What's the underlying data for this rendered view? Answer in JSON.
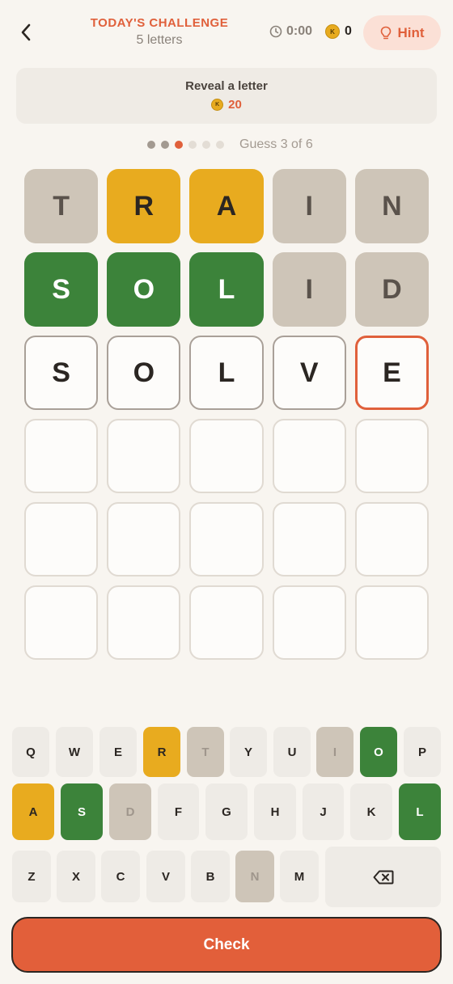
{
  "header": {
    "title": "TODAY'S CHALLENGE",
    "subtitle": "5 letters",
    "timer": "0:00",
    "coins": "0",
    "hint_label": "Hint",
    "coin_symbol": "K"
  },
  "reveal": {
    "title": "Reveal a letter",
    "cost": "20"
  },
  "progress": {
    "label": "Guess 3 of 6",
    "total": 6,
    "current": 3
  },
  "board": {
    "rows": [
      [
        {
          "l": "T",
          "s": "absent"
        },
        {
          "l": "R",
          "s": "present"
        },
        {
          "l": "A",
          "s": "present"
        },
        {
          "l": "I",
          "s": "absent"
        },
        {
          "l": "N",
          "s": "absent"
        }
      ],
      [
        {
          "l": "S",
          "s": "correct"
        },
        {
          "l": "O",
          "s": "correct"
        },
        {
          "l": "L",
          "s": "correct"
        },
        {
          "l": "I",
          "s": "absent"
        },
        {
          "l": "D",
          "s": "absent"
        }
      ],
      [
        {
          "l": "S",
          "s": "typed"
        },
        {
          "l": "O",
          "s": "typed"
        },
        {
          "l": "L",
          "s": "typed"
        },
        {
          "l": "V",
          "s": "typed"
        },
        {
          "l": "E",
          "s": "active"
        }
      ],
      [
        {
          "l": "",
          "s": "empty"
        },
        {
          "l": "",
          "s": "empty"
        },
        {
          "l": "",
          "s": "empty"
        },
        {
          "l": "",
          "s": "empty"
        },
        {
          "l": "",
          "s": "empty"
        }
      ],
      [
        {
          "l": "",
          "s": "empty"
        },
        {
          "l": "",
          "s": "empty"
        },
        {
          "l": "",
          "s": "empty"
        },
        {
          "l": "",
          "s": "empty"
        },
        {
          "l": "",
          "s": "empty"
        }
      ],
      [
        {
          "l": "",
          "s": "empty"
        },
        {
          "l": "",
          "s": "empty"
        },
        {
          "l": "",
          "s": "empty"
        },
        {
          "l": "",
          "s": "empty"
        },
        {
          "l": "",
          "s": "empty"
        }
      ]
    ]
  },
  "keyboard": {
    "rows": [
      [
        {
          "k": "Q",
          "s": "normal"
        },
        {
          "k": "W",
          "s": "normal"
        },
        {
          "k": "E",
          "s": "normal"
        },
        {
          "k": "R",
          "s": "present"
        },
        {
          "k": "T",
          "s": "absent"
        },
        {
          "k": "Y",
          "s": "normal"
        },
        {
          "k": "U",
          "s": "normal"
        },
        {
          "k": "I",
          "s": "absent"
        },
        {
          "k": "O",
          "s": "correct"
        },
        {
          "k": "P",
          "s": "normal"
        }
      ],
      [
        {
          "k": "A",
          "s": "present"
        },
        {
          "k": "S",
          "s": "correct"
        },
        {
          "k": "D",
          "s": "absent"
        },
        {
          "k": "F",
          "s": "normal"
        },
        {
          "k": "G",
          "s": "normal"
        },
        {
          "k": "H",
          "s": "normal"
        },
        {
          "k": "J",
          "s": "normal"
        },
        {
          "k": "K",
          "s": "normal"
        },
        {
          "k": "L",
          "s": "correct"
        }
      ],
      [
        {
          "k": "Z",
          "s": "normal"
        },
        {
          "k": "X",
          "s": "normal"
        },
        {
          "k": "C",
          "s": "normal"
        },
        {
          "k": "V",
          "s": "normal"
        },
        {
          "k": "B",
          "s": "normal"
        },
        {
          "k": "N",
          "s": "absent"
        },
        {
          "k": "M",
          "s": "normal"
        },
        {
          "k": "",
          "s": "normal",
          "icon": "backspace-icon"
        }
      ]
    ]
  },
  "check_label": "Check",
  "colors": {
    "accent": "#e0603b",
    "correct": "#3c833a",
    "present": "#e8ab1f",
    "absent": "#cec5b8"
  }
}
